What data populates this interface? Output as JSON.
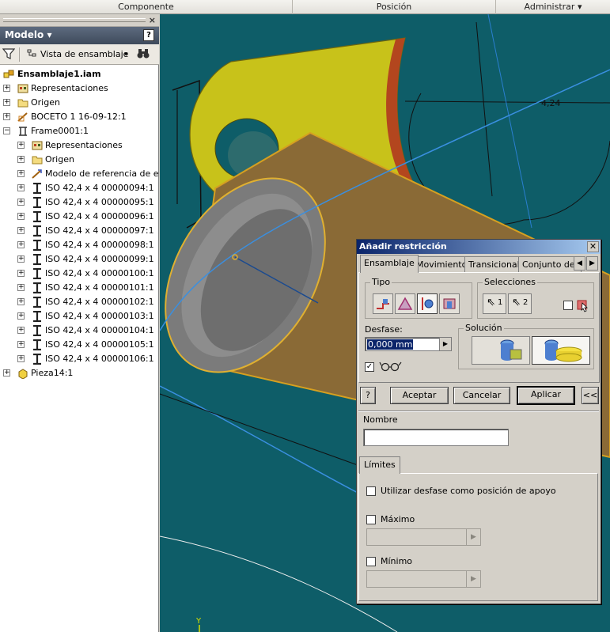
{
  "ribbon": {
    "tab1": "Componente",
    "tab2": "Posición",
    "tab3": "Administrar"
  },
  "browser": {
    "title": "Modelo",
    "help": "?",
    "close": "×",
    "view_label": "Vista de ensamblaje",
    "tree": [
      {
        "label": "Ensamblaje1.iam",
        "bold": true
      },
      {
        "label": "Representaciones"
      },
      {
        "label": "Origen"
      },
      {
        "label": "BOCETO 1 16-09-12:1"
      },
      {
        "label": "Frame0001:1"
      },
      {
        "label": "Representaciones"
      },
      {
        "label": "Origen"
      },
      {
        "label": "Modelo de referencia de estructura"
      },
      {
        "label": "ISO 42,4 x 4 00000094:1"
      },
      {
        "label": "ISO 42,4 x 4 00000095:1"
      },
      {
        "label": "ISO 42,4 x 4 00000096:1"
      },
      {
        "label": "ISO 42,4 x 4 00000097:1"
      },
      {
        "label": "ISO 42,4 x 4 00000098:1"
      },
      {
        "label": "ISO 42,4 x 4 00000099:1"
      },
      {
        "label": "ISO 42,4 x 4 00000100:1"
      },
      {
        "label": "ISO 42,4 x 4 00000101:1"
      },
      {
        "label": "ISO 42,4 x 4 00000102:1"
      },
      {
        "label": "ISO 42,4 x 4 00000103:1"
      },
      {
        "label": "ISO 42,4 x 4 00000104:1"
      },
      {
        "label": "ISO 42,4 x 4 00000105:1"
      },
      {
        "label": "ISO 42,4 x 4 00000106:1"
      },
      {
        "label": "Pieza14:1"
      }
    ]
  },
  "viewport": {
    "dimension": "4,24",
    "axis": "Y"
  },
  "dialog": {
    "title": "Añadir restricción",
    "tabs": [
      "Ensamblaje",
      "Movimiento",
      "Transicional",
      "Conjunto de restricciones"
    ],
    "tipo_label": "Tipo",
    "selecciones_label": "Selecciones",
    "sel1": "1",
    "sel2": "2",
    "desfase_label": "Desfase:",
    "desfase_value": "0,000 mm",
    "solucion_label": "Solución",
    "accept": "Aceptar",
    "cancel": "Cancelar",
    "apply": "Aplicar",
    "more": "<<",
    "help": "?",
    "nombre_label": "Nombre",
    "nombre_value": "",
    "limites_tab": "Límites",
    "use_offset": "Utilizar desfase como posición de apoyo",
    "max_label": "Máximo",
    "min_label": "Mínimo"
  },
  "colors": {
    "viewport_bg": "#0e5d68",
    "part_yellow": "#c8c21a",
    "tube_brown": "#8a6a36",
    "dialog_title": "#0a246a"
  }
}
